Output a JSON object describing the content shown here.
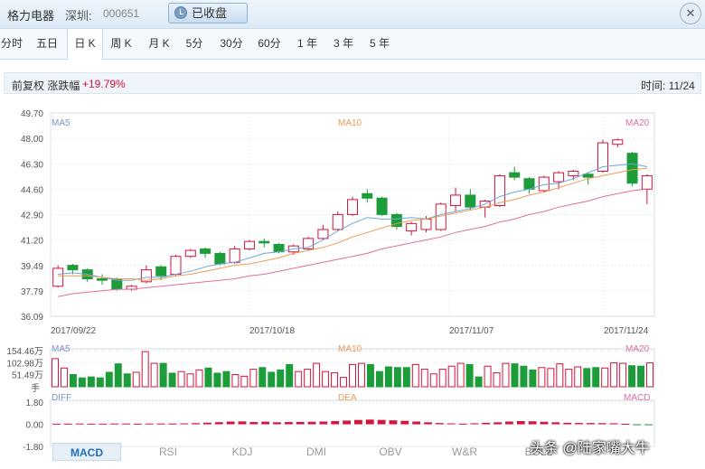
{
  "header": {
    "stock_name": "格力电器",
    "market": "深圳:",
    "code": "000651",
    "status": "已收盘",
    "close_glyph": "✕"
  },
  "tabs": [
    {
      "label": "分时"
    },
    {
      "label": "五日"
    },
    {
      "label": "日 K"
    },
    {
      "label": "周 K"
    },
    {
      "label": "月 K"
    },
    {
      "label": "5分"
    },
    {
      "label": "30分"
    },
    {
      "label": "60分"
    },
    {
      "label": "1 年"
    },
    {
      "label": "3 年"
    },
    {
      "label": "5 年"
    }
  ],
  "active_tab": "日 K",
  "info": {
    "adjust_label": "前复权 涨跌幅",
    "change_pct": "+19.79%",
    "time_label": "时间: 11/24"
  },
  "colors": {
    "up": "#d4143a",
    "down": "#1d9c3a",
    "ma5": "#6aa8d8",
    "ma10": "#ee9b55",
    "ma20": "#e06fa0",
    "accent": "#1d6fb8"
  },
  "chart_data": [
    {
      "type": "candlestick",
      "title": "",
      "y_ticks": [
        "49.70",
        "48.00",
        "46.30",
        "44.60",
        "42.90",
        "41.20",
        "39.49",
        "37.79",
        "36.09"
      ],
      "ylim": [
        36.09,
        49.7
      ],
      "x_ticks": [
        "2017/09/22",
        "2017/10/18",
        "2017/11/07",
        "2017/11/24"
      ],
      "legend": [
        "MA5",
        "MA10",
        "MA20"
      ],
      "candles": [
        [
          38.1,
          39.3,
          38.0,
          39.5
        ],
        [
          39.5,
          39.2,
          38.9,
          39.6
        ],
        [
          39.2,
          38.6,
          38.4,
          39.3
        ],
        [
          38.6,
          38.5,
          38.2,
          38.9
        ],
        [
          38.6,
          37.9,
          37.8,
          38.7
        ],
        [
          37.9,
          38.1,
          37.8,
          38.2
        ],
        [
          38.4,
          39.2,
          38.3,
          39.5
        ],
        [
          39.4,
          38.8,
          38.5,
          39.5
        ],
        [
          38.9,
          40.1,
          38.8,
          40.2
        ],
        [
          40.1,
          40.5,
          40.0,
          40.6
        ],
        [
          40.6,
          40.3,
          40.0,
          40.7
        ],
        [
          40.3,
          39.6,
          39.5,
          40.4
        ],
        [
          39.7,
          40.6,
          39.6,
          40.8
        ],
        [
          40.6,
          41.1,
          40.5,
          41.2
        ],
        [
          41.1,
          41.0,
          40.7,
          41.3
        ],
        [
          40.9,
          40.4,
          40.3,
          41.0
        ],
        [
          40.4,
          40.8,
          40.2,
          40.9
        ],
        [
          40.6,
          41.3,
          40.5,
          41.4
        ],
        [
          41.3,
          41.9,
          41.2,
          42.2
        ],
        [
          41.9,
          42.9,
          41.8,
          43.1
        ],
        [
          42.9,
          43.9,
          42.8,
          44.1
        ],
        [
          44.3,
          44.0,
          43.7,
          44.6
        ],
        [
          44.0,
          42.9,
          42.8,
          44.1
        ],
        [
          42.9,
          42.1,
          41.9,
          43.0
        ],
        [
          41.8,
          42.3,
          41.5,
          42.4
        ],
        [
          41.9,
          42.6,
          41.7,
          42.8
        ],
        [
          41.9,
          43.6,
          41.8,
          43.7
        ],
        [
          43.5,
          44.2,
          43.1,
          44.7
        ],
        [
          44.2,
          43.4,
          43.2,
          44.6
        ],
        [
          43.4,
          43.8,
          42.7,
          43.9
        ],
        [
          43.5,
          45.5,
          43.4,
          45.6
        ],
        [
          45.7,
          45.4,
          45.2,
          46.1
        ],
        [
          45.3,
          44.6,
          44.3,
          45.4
        ],
        [
          44.5,
          45.4,
          44.4,
          45.5
        ],
        [
          45.1,
          45.7,
          44.6,
          45.8
        ],
        [
          45.5,
          45.8,
          45.2,
          45.9
        ],
        [
          45.6,
          45.4,
          44.9,
          45.7
        ],
        [
          45.8,
          47.7,
          45.7,
          47.9
        ],
        [
          47.6,
          47.9,
          47.4,
          48.0
        ],
        [
          47.0,
          45.0,
          44.8,
          47.1
        ],
        [
          44.6,
          45.5,
          43.6,
          45.6
        ]
      ],
      "ma5": [
        38.9,
        39.0,
        38.9,
        38.7,
        38.5,
        38.5,
        38.7,
        38.7,
        38.9,
        39.1,
        39.4,
        39.6,
        39.7,
        40.0,
        40.3,
        40.4,
        40.6,
        40.7,
        41.2,
        41.8,
        42.3,
        42.7,
        42.6,
        42.6,
        42.7,
        42.6,
        42.9,
        43.1,
        43.3,
        43.6,
        44.1,
        44.4,
        44.6,
        44.9,
        45.0,
        45.3,
        45.7,
        46.1,
        46.2,
        46.3,
        46.1
      ],
      "ma10": [
        38.8,
        38.8,
        38.8,
        38.7,
        38.6,
        38.6,
        38.5,
        38.6,
        38.8,
        38.9,
        39.1,
        39.3,
        39.5,
        39.6,
        39.8,
        40.0,
        40.3,
        40.5,
        40.7,
        41.0,
        41.4,
        41.7,
        42.0,
        42.3,
        42.5,
        42.6,
        42.8,
        43.0,
        43.2,
        43.4,
        43.7,
        43.9,
        44.2,
        44.4,
        44.7,
        45.0,
        45.3,
        45.5,
        45.7,
        45.9,
        46.0
      ],
      "ma20": [
        37.4,
        37.6,
        37.7,
        37.8,
        37.9,
        37.9,
        38.0,
        38.1,
        38.2,
        38.3,
        38.4,
        38.5,
        38.6,
        38.8,
        38.9,
        39.1,
        39.3,
        39.5,
        39.7,
        39.9,
        40.1,
        40.3,
        40.6,
        40.8,
        41.0,
        41.2,
        41.4,
        41.7,
        41.9,
        42.1,
        42.4,
        42.6,
        42.9,
        43.1,
        43.4,
        43.6,
        43.8,
        44.1,
        44.3,
        44.5,
        44.6
      ]
    },
    {
      "type": "bar",
      "title": "volume",
      "y_ticks": [
        "154.46万",
        "102.98万",
        "51.49万",
        "手"
      ],
      "ylim": [
        0,
        154.46
      ],
      "unit": "万",
      "legend": [
        "MA5",
        "MA10",
        "MA20"
      ],
      "values": [
        120,
        80,
        52,
        38,
        42,
        38,
        62,
        98,
        55,
        62,
        150,
        100,
        100,
        58,
        65,
        55,
        72,
        80,
        58,
        65,
        52,
        45,
        75,
        82,
        62,
        72,
        95,
        65,
        75,
        100,
        65,
        60,
        40,
        95,
        100,
        95,
        65,
        85,
        82,
        82,
        95,
        75,
        55,
        75,
        88,
        100,
        95,
        42,
        88,
        60,
        100,
        98,
        88,
        72,
        82,
        78,
        98,
        75,
        85,
        78,
        82,
        80,
        102,
        100,
        90,
        88,
        102
      ]
    },
    {
      "type": "bar",
      "title": "MACD",
      "y_ticks": [
        "1.80",
        "0.00",
        "-1.80"
      ],
      "ylim": [
        -1.8,
        1.8
      ],
      "legend": [
        "DIFF",
        "DEA",
        "MACD"
      ],
      "values": [
        0.05,
        0.05,
        0.06,
        0.05,
        0.05,
        0.06,
        0.06,
        0.05,
        0.06,
        0.06,
        0.06,
        0.07,
        0.09,
        0.13,
        0.17,
        0.22,
        0.23,
        0.18,
        0.21,
        0.16,
        0.18,
        0.19,
        0.2,
        0.22,
        0.26,
        0.3,
        0.35,
        0.38,
        0.35,
        0.32,
        0.28,
        0.22,
        0.16,
        0.1,
        0.07,
        0.05,
        0.08,
        0.12,
        0.16,
        0.22,
        0.26,
        0.24,
        0.2,
        0.16,
        0.12,
        0.1,
        0.1,
        0.09,
        0.08,
        0.04,
        -0.02,
        -0.06
      ]
    }
  ],
  "bottom_tabs": [
    "MACD",
    "RSI",
    "KDJ",
    "DMI",
    "OBV",
    "W&R",
    "BOLL"
  ],
  "active_bottom_tab": "MACD",
  "watermark": "头条 @陆家嘴大牛"
}
